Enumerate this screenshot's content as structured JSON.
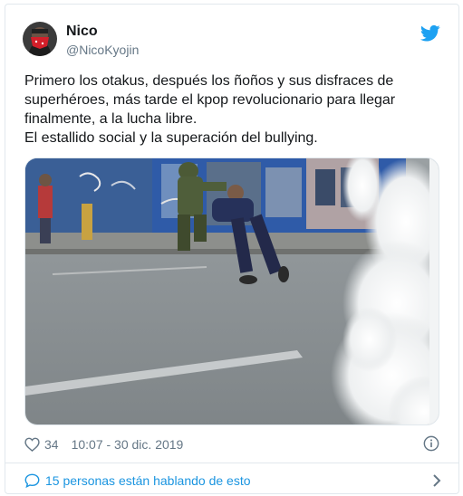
{
  "author": {
    "display_name": "Nico",
    "handle": "@NicoKyojin",
    "avatar_icon": "avatar-red-bandana"
  },
  "brand": {
    "icon": "twitter-bird-icon",
    "color": "#1da1f2"
  },
  "tweet": {
    "lines": [
      "Primero los otakus, después los ñoños y sus disfraces de superhéroes, más tarde el kpop revolucionario para llegar finalmente, a la lucha libre.",
      "El estallido social y la superación del bullying."
    ]
  },
  "photo": {
    "icon": "tweet-photo"
  },
  "meta": {
    "like_count": "34",
    "timestamp": "10:07 - 30 dic. 2019",
    "like_icon": "heart-icon",
    "info_icon": "info-icon"
  },
  "footer": {
    "conversation_label": "15 personas están hablando de esto",
    "conversation_icon": "speech-bubble-icon",
    "chevron_icon": "chevron-right-icon",
    "link_color": "#1b95e0"
  }
}
